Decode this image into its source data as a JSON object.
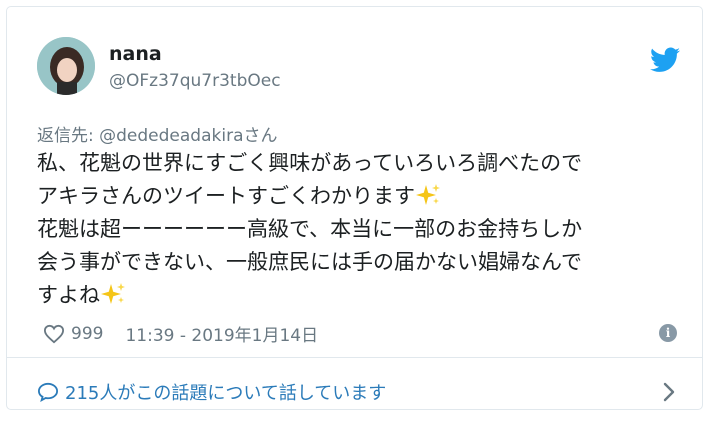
{
  "user": {
    "display_name": "nana",
    "handle": "@OFz37qu7r3tbOec"
  },
  "reply": {
    "prefix": "返信先: ",
    "mention": "@dededeadakira",
    "suffix": "さん"
  },
  "tweet": {
    "line1": "私、花魁の世界にすごく興味があっていろいろ調べたので",
    "line2": "アキラさんのツイートすごくわかります",
    "line3": "花魁は超ーーーーーー高級で、本当に一部のお金持ちしか",
    "line4": "会う事ができない、一般庶民には手の届かない娼婦なんで",
    "line5": "すよね"
  },
  "meta": {
    "likes": "999",
    "timestamp": "11:39 - 2019年1月14日"
  },
  "footer": {
    "conversation": "215人がこの話題について話しています"
  },
  "icons": {
    "bird": "twitter-bird-icon",
    "heart": "heart-icon",
    "info": "info-icon",
    "bubble": "speech-bubble-icon",
    "chevron": "chevron-right-icon",
    "sparkle": "sparkles-emoji"
  },
  "colors": {
    "twitter_blue": "#1da1f2",
    "link_blue": "#2b7bb9",
    "muted": "#697882",
    "text": "#1c2022",
    "border": "#e1e8ed",
    "sparkle": "#f5c518"
  }
}
